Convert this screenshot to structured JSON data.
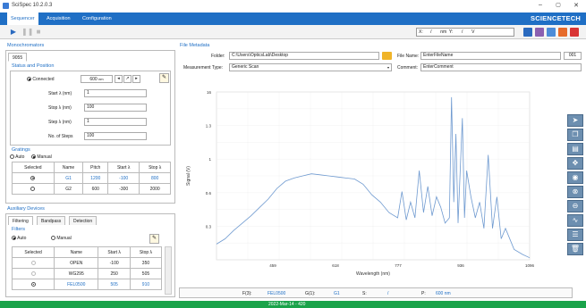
{
  "window": {
    "title": "SciSpec 10.2.0.3",
    "min": "–",
    "max": "▢",
    "close": "✕"
  },
  "menu": {
    "items": [
      "Sequencer",
      "Acquisition",
      "Configuration"
    ],
    "brand": "SCIENCETECH"
  },
  "toolbar": {
    "x_label": "X:",
    "x_value": "/",
    "x_unit": "nm",
    "y_label": "Y:",
    "y_value": "/",
    "y_unit": "V"
  },
  "mono": {
    "title": "Monochromators",
    "tab": "9055",
    "status_title": "Status and Position",
    "connected": "Connected",
    "position": "600",
    "position_unit": "nm",
    "start_label": "Start λ   (nm)",
    "start": "1",
    "stop_label": "Stop λ    (nm)",
    "stop": "100",
    "step_label": "Step λ    (nm)",
    "step": "1",
    "nsteps_label": "No. of Steps",
    "nsteps": "100"
  },
  "gratings": {
    "title": "Gratings",
    "auto": "Auto",
    "manual": "Manual",
    "headers": [
      "Selected",
      "Name",
      "Pitch",
      "Start λ",
      "Stop λ"
    ],
    "rows": [
      [
        "G1",
        "1200",
        "-100",
        "800"
      ],
      [
        "G2",
        "600",
        "-300",
        "2000"
      ]
    ]
  },
  "aux": {
    "title": "Auxiliary Devices",
    "tabs": [
      "Filtering",
      "Bandpass",
      "Detection"
    ],
    "filters_title": "Filters",
    "auto": "Auto",
    "manual": "Manual",
    "headers": [
      "Selected",
      "Name",
      "Start λ",
      "Stop λ"
    ],
    "rows": [
      [
        "OPEN",
        "-100",
        "350"
      ],
      [
        "WG295",
        "250",
        "505"
      ],
      [
        "FEL0500",
        "505",
        "910"
      ]
    ]
  },
  "file": {
    "title": "File Metadata",
    "folder_label": "Folder:",
    "folder": "C:\\Users\\OpticsLab\\Desktop",
    "filename_label": "File Name:",
    "filename": "EnterFileName",
    "index": "001",
    "mtype_label": "Measurement Type:",
    "mtype": "Generic Scan",
    "comment_label": "Comment:",
    "comment": "EnterComment"
  },
  "chart_data": {
    "type": "line",
    "xlabel": "Wavelength (nm)",
    "ylabel": "Signal (V)",
    "xticks": [
      "459",
      "618",
      "777",
      "936",
      "1096"
    ],
    "yticks": [
      "16",
      "1.3",
      "1",
      "0.6",
      "0.3"
    ],
    "xlim": [
      370,
      1096
    ],
    "ylim": [
      0,
      1.6
    ],
    "series": [
      {
        "x": [
          370,
          390,
          410,
          430,
          450,
          470,
          490,
          510,
          530,
          550,
          570,
          590,
          610,
          630,
          650,
          670,
          690,
          710,
          730,
          750,
          770,
          790,
          800,
          810,
          820,
          830,
          840,
          850,
          860,
          870,
          880,
          890,
          900,
          910,
          915,
          920,
          925,
          930,
          940,
          945,
          950,
          960,
          970,
          980,
          990,
          1000,
          1010,
          1020,
          1030,
          1040,
          1060,
          1080,
          1096
        ],
        "y": [
          0.15,
          0.2,
          0.28,
          0.35,
          0.42,
          0.5,
          0.58,
          0.68,
          0.75,
          0.78,
          0.8,
          0.82,
          0.81,
          0.8,
          0.79,
          0.78,
          0.77,
          0.72,
          0.62,
          0.55,
          0.45,
          0.4,
          0.65,
          0.38,
          0.55,
          0.4,
          0.85,
          0.45,
          0.7,
          0.42,
          0.6,
          0.5,
          0.35,
          0.4,
          1.55,
          0.55,
          1.2,
          0.35,
          1.35,
          0.4,
          0.85,
          0.6,
          0.4,
          0.55,
          0.3,
          1.0,
          0.3,
          0.6,
          0.2,
          0.3,
          0.1,
          0.05,
          0.02
        ]
      }
    ]
  },
  "statusbar": {
    "f3_label": "F(3):",
    "f3": "FEL0500",
    "g1_label": "G(1):",
    "g1": "G1",
    "s_label": "S:",
    "s": "/",
    "p_label": "P:",
    "p": "600 nm"
  },
  "footer": {
    "text": "2022-Mar-14 - 420"
  }
}
